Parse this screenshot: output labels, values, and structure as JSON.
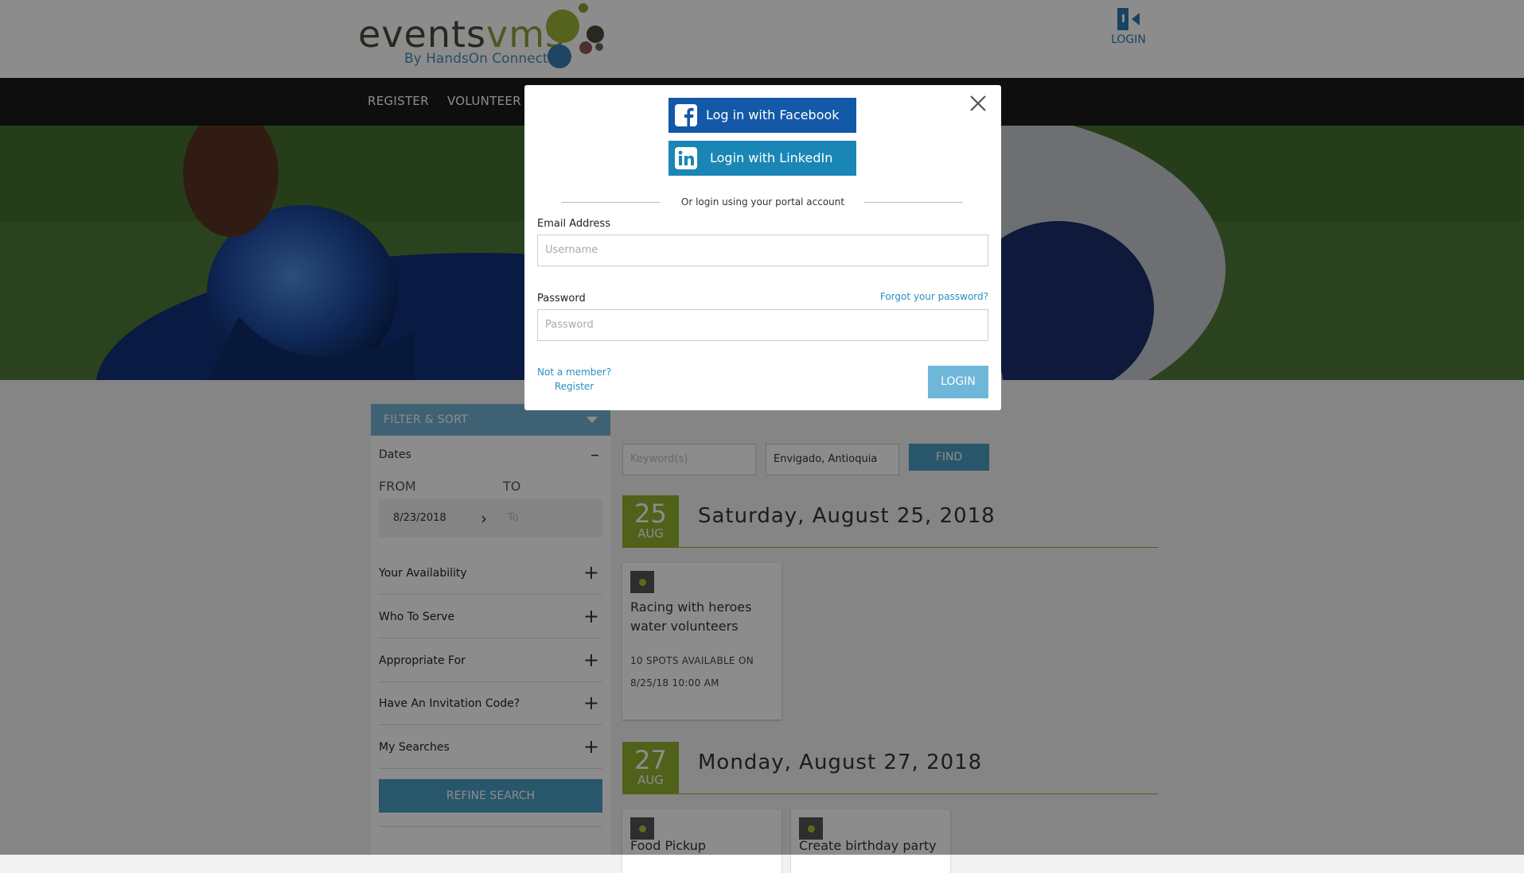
{
  "header": {
    "logo_word_a": "events",
    "logo_word_b": "vms",
    "logo_sub": "By HandsOn Connect",
    "login_label": "LOGIN"
  },
  "nav": {
    "items": [
      "REGISTER",
      "VOLUNTEER C"
    ]
  },
  "sidebar": {
    "filter_title": "FILTER & SORT",
    "dates_label": "Dates",
    "from_label": "FROM",
    "to_label": "TO",
    "from_value": "8/23/2018",
    "to_placeholder": "To",
    "facets": [
      "Your Availability",
      "Who To Serve",
      "Appropriate For",
      "Have An Invitation Code?",
      "My Searches"
    ],
    "refine_label": "REFINE SEARCH"
  },
  "search": {
    "keyword_placeholder": "Keyword(s)",
    "location_value": "Envigado, Antioquia",
    "find_label": "FIND"
  },
  "days": [
    {
      "day": "25",
      "month": "AUG",
      "heading": "Saturday, August 25, 2018",
      "cards": [
        {
          "title": "Racing with heroes water volunteers",
          "spots": "10 SPOTS AVAILABLE ON",
          "when": "8/25/18 10:00 AM"
        }
      ]
    },
    {
      "day": "27",
      "month": "AUG",
      "heading": "Monday, August 27, 2018",
      "cards": [
        {
          "title": "Food Pickup"
        },
        {
          "title": "Create birthday party"
        }
      ]
    }
  ],
  "modal": {
    "facebook_label": "Log in with Facebook",
    "linkedin_label": "Login with LinkedIn",
    "or_text": "Or login using your portal account",
    "email_label": "Email Address",
    "email_placeholder": "Username",
    "password_label": "Password",
    "password_placeholder": "Password",
    "forgot_label": "Forgot your password?",
    "not_member": "Not a member?",
    "register_link": "Register",
    "login_button": "LOGIN"
  },
  "colors": {
    "accent_green": "#93b130",
    "facebook_blue": "#1458a8",
    "linkedin_blue": "#1a86b5",
    "link_blue": "#2a8fc0"
  }
}
